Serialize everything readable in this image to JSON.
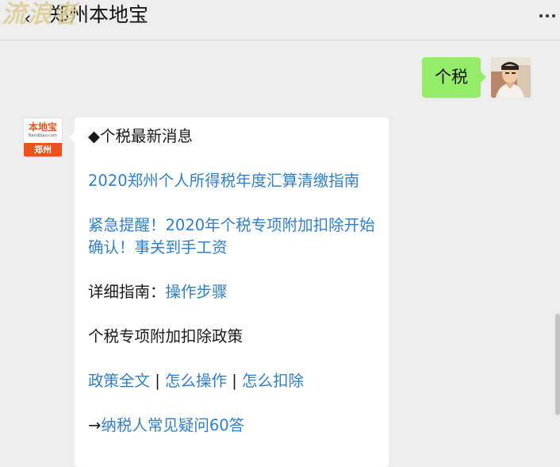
{
  "header": {
    "watermark": "流浪者",
    "back_icon": "chevron-left-icon",
    "title": "郑州本地宝",
    "more_icon": "more-dots-icon"
  },
  "conversation": {
    "user_message": {
      "text": "个税",
      "bubble_color": "#95ec69"
    },
    "bot_avatar": {
      "logo_text": "本地宝",
      "logo_url": "Bendibao.com",
      "logo_city": "郑州",
      "brand_color": "#e8541c"
    },
    "bot_message": {
      "heading_icon": "◆",
      "heading": "个税最新消息",
      "link_1": "2020郑州个人所得税年度汇算清缴指南",
      "link_2": "紧急提醒！2020年个税专项附加扣除开始确认！事关到手工资",
      "guide_label": "详细指南：",
      "guide_link": "操作步骤",
      "policy_heading": "个税专项附加扣除政策",
      "policy_link_full": "政策全文",
      "policy_sep_1": " | ",
      "policy_link_how": "怎么操作",
      "policy_sep_2": " | ",
      "policy_link_deduct": "怎么扣除",
      "faq_arrow": "→",
      "faq_link": "纳税人常见疑问60答",
      "link_color": "#2f7fcf"
    }
  }
}
